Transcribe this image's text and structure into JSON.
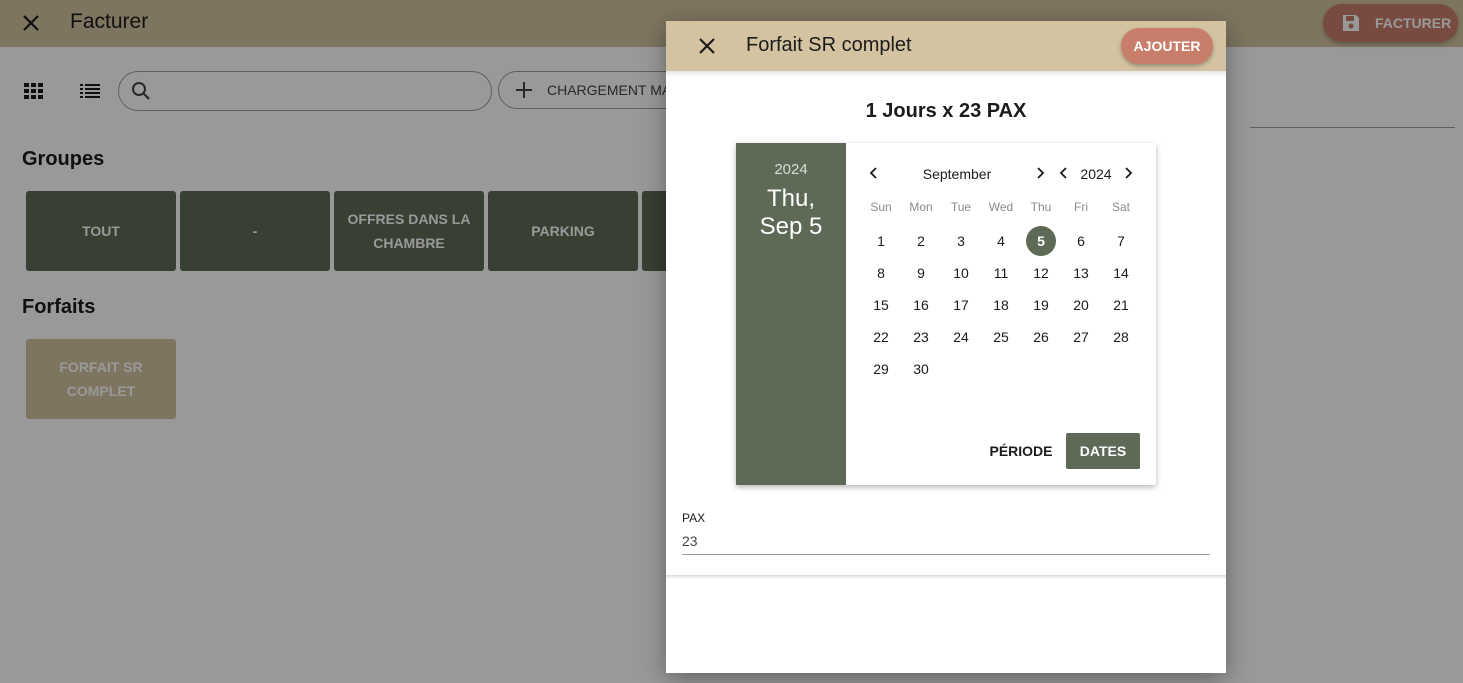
{
  "app": {
    "title": "Facturer",
    "facturer_label": "FACTURER",
    "search": {
      "placeholder": "",
      "value": ""
    },
    "chargement_label": "CHARGEMENT MA",
    "groupes_title": "Groupes",
    "groupes": [
      "TOUT",
      "-",
      "OFFRES DANS LA CHAMBRE",
      "PARKING",
      ""
    ],
    "forfaits_title": "Forfaits",
    "forfaits": [
      "FORFAIT SR COMPLET"
    ]
  },
  "dialog": {
    "title": "Forfait SR complet",
    "ajouter_label": "AJOUTER",
    "summary": "1 Jours x 23 PAX",
    "picker": {
      "year": "2024",
      "date_line1": "Thu,",
      "date_line2": "Sep 5",
      "month": "September",
      "nav_year": "2024",
      "weekdays": [
        "Sun",
        "Mon",
        "Tue",
        "Wed",
        "Thu",
        "Fri",
        "Sat"
      ],
      "first_weekday_index": 0,
      "days_in_month": 30,
      "selected_day": 5,
      "periode_label": "PÉRIODE",
      "dates_label": "DATES"
    },
    "pax": {
      "label": "PAX",
      "value": "23"
    }
  },
  "colors": {
    "header": "#d3c3a1",
    "accent": "#c97e6b",
    "primary": "#5e6a56"
  }
}
